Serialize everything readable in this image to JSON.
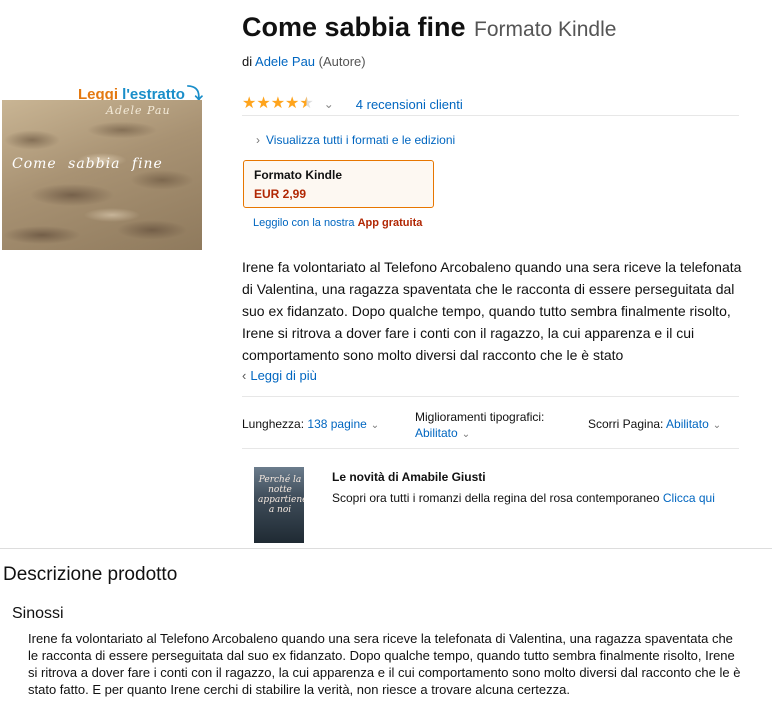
{
  "sample": {
    "word1": "Leggi",
    "word2": "l'estratto",
    "arrow": "⤵"
  },
  "cover": {
    "author": "Adele Pau",
    "title": "Come sabbia fine"
  },
  "product": {
    "title": "Come sabbia fine",
    "format": "Formato Kindle",
    "by_prefix": "di",
    "author": "Adele Pau",
    "author_role": "(Autore)",
    "rating": 4.5,
    "rating_caret": "⌄",
    "reviews_label": "4 recensioni clienti",
    "all_formats": "Visualizza tutti i formati e le edizioni",
    "format_box": {
      "name": "Formato Kindle",
      "price": "EUR 2,99"
    },
    "app_prefix": "Leggilo con la nostra",
    "app_link": "App gratuita"
  },
  "description": {
    "text": "Irene fa volontariato al Telefono Arcobaleno quando una sera riceve la telefonata di Valentina, una ragazza spaventata che le racconta di essere perseguitata dal suo ex fidanzato. Dopo qualche tempo, quando tutto sembra finalmente risolto, Irene si ritrova a dover fare i conti con il ragazzo, la cui apparenza e il cui comportamento sono molto diversi dal racconto che le è stato",
    "read_more": "Leggi di più"
  },
  "specs": {
    "length_label": "Lunghezza:",
    "length_value": "138 pagine",
    "typo_label": "Miglioramenti tipografici:",
    "typo_value": "Abilitato",
    "scroll_label": "Scorri Pagina:",
    "scroll_value": "Abilitato"
  },
  "promo": {
    "image_text": "Perché la notte appartiene a noi",
    "title": "Le novità di Amabile Giusti",
    "text": "Scopri ora tutti i romanzi della regina del rosa contemporaneo",
    "link": "Clicca qui"
  },
  "section": {
    "title": "Descrizione prodotto",
    "subtitle": "Sinossi",
    "synopsis": "Irene fa volontariato al Telefono Arcobaleno quando una sera riceve la telefonata di Valentina, una ragazza spaventata che le racconta di essere perseguitata dal suo ex fidanzato. Dopo qualche tempo, quando tutto sembra finalmente risolto, Irene si ritrova a dover fare i conti con il ragazzo, la cui apparenza e il cui comportamento sono molto diversi dal racconto che le è stato fatto. E per quanto Irene cerchi di stabilire la verità, non riesce a trovare alcuna certezza."
  },
  "colors": {
    "link": "#0066c0",
    "price": "#b12704",
    "star": "#ffa41c",
    "sample_orange": "#e47911",
    "sample_blue": "#1a8ec9"
  }
}
